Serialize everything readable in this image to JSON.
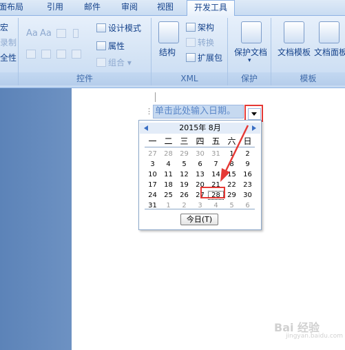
{
  "ribbon_tabs": [
    {
      "label": "面布局"
    },
    {
      "label": "引用"
    },
    {
      "label": "邮件"
    },
    {
      "label": "审阅"
    },
    {
      "label": "视图"
    },
    {
      "label": "开发工具",
      "active": true
    }
  ],
  "left_cut_items": [
    "宏",
    "录制",
    "全性"
  ],
  "controls_group": {
    "label": "控件",
    "design_mode": "设计模式",
    "properties": "属性",
    "group": "组合",
    "aa1": "Aa",
    "aa2": "Aa"
  },
  "xml_group": {
    "label": "XML",
    "structure": "结构",
    "schema": "架构",
    "transform": "转换",
    "expansion": "扩展包"
  },
  "protect_group": {
    "label": "保护",
    "protect_doc": "保护文档"
  },
  "templates_group": {
    "label": "模板",
    "doc_template": "文档模板",
    "doc_panel": "文档面板"
  },
  "content_control": {
    "placeholder": "单击此处输入日期。"
  },
  "calendar": {
    "title": "2015年 8月",
    "weekdays": [
      "一",
      "二",
      "三",
      "四",
      "五",
      "六",
      "日"
    ],
    "weeks": [
      [
        "27",
        "28",
        "29",
        "30",
        "31",
        "1",
        "2"
      ],
      [
        "3",
        "4",
        "5",
        "6",
        "7",
        "8",
        "9"
      ],
      [
        "10",
        "11",
        "12",
        "13",
        "14",
        "15",
        "16"
      ],
      [
        "17",
        "18",
        "19",
        "20",
        "21",
        "22",
        "23"
      ],
      [
        "24",
        "25",
        "26",
        "27",
        "28",
        "29",
        "30"
      ],
      [
        "31",
        "1",
        "2",
        "3",
        "4",
        "5",
        "6"
      ]
    ],
    "selected_day": "28",
    "today_label": "今日(T)"
  },
  "watermark": {
    "line1": "Bai 经验",
    "line2": "jingyan.baidu.com"
  },
  "colors": {
    "accent_red": "#e53935",
    "ribbon_text": "#15428b"
  }
}
